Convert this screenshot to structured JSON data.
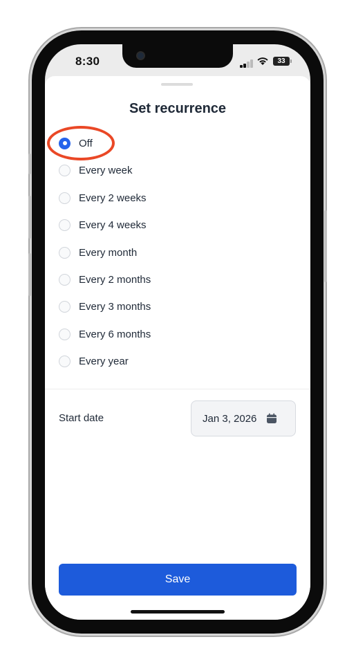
{
  "status_bar": {
    "time": "8:30",
    "battery": "33"
  },
  "sheet": {
    "title": "Set recurrence",
    "options": [
      {
        "label": "Off",
        "selected": true
      },
      {
        "label": "Every week",
        "selected": false
      },
      {
        "label": "Every 2 weeks",
        "selected": false
      },
      {
        "label": "Every 4 weeks",
        "selected": false
      },
      {
        "label": "Every month",
        "selected": false
      },
      {
        "label": "Every 2 months",
        "selected": false
      },
      {
        "label": "Every 3 months",
        "selected": false
      },
      {
        "label": "Every 6 months",
        "selected": false
      },
      {
        "label": "Every year",
        "selected": false
      }
    ],
    "start_date": {
      "label": "Start date",
      "value": "Jan 3, 2026"
    },
    "save_label": "Save"
  },
  "colors": {
    "accent": "#2563eb",
    "save_button": "#1d5bdb",
    "highlight": "#ea4826"
  }
}
